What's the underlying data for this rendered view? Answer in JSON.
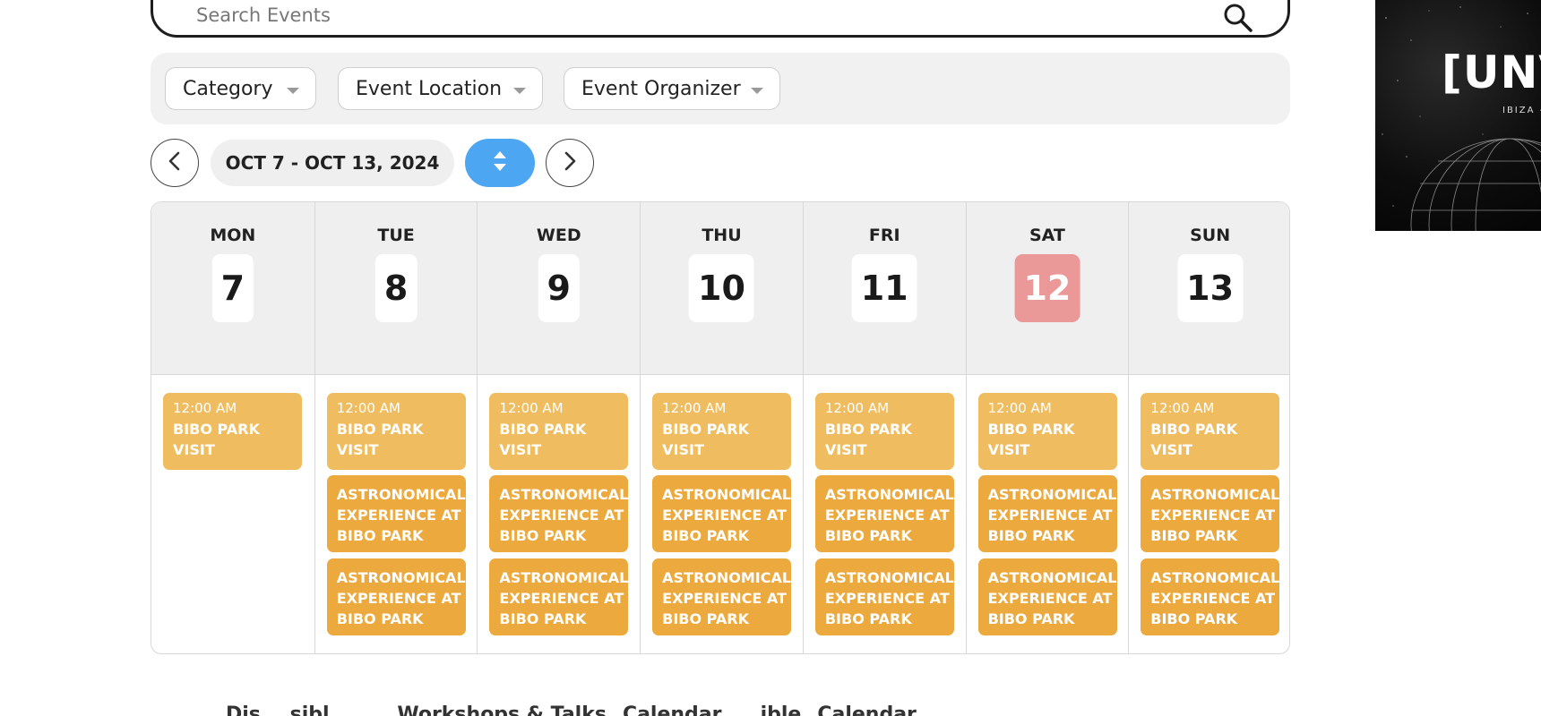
{
  "search": {
    "placeholder": "Search Events"
  },
  "filters": {
    "category": "Category",
    "location": "Event Location",
    "organizer": "Event Organizer"
  },
  "nav": {
    "date_range": "OCT 7 - OCT 13, 2024"
  },
  "colors": {
    "today_highlight": "#ea9898",
    "event_light": "#efbd5f",
    "event_dark": "#eca93d",
    "toggle_button": "#4da6f2"
  },
  "calendar": {
    "days": [
      {
        "name": "MON",
        "number": "7",
        "today": false,
        "events": [
          {
            "time": "12:00 AM",
            "title": "BIBO PARK\nVISIT"
          }
        ]
      },
      {
        "name": "TUE",
        "number": "8",
        "today": false,
        "events": [
          {
            "time": "12:00 AM",
            "title": "BIBO PARK\nVISIT"
          },
          {
            "title": "ASTRONOMICAL\nEXPERIENCE AT\nBIBO PARK"
          },
          {
            "title": "ASTRONOMICAL\nEXPERIENCE AT\nBIBO PARK"
          }
        ]
      },
      {
        "name": "WED",
        "number": "9",
        "today": false,
        "events": [
          {
            "time": "12:00 AM",
            "title": "BIBO PARK\nVISIT"
          },
          {
            "title": "ASTRONOMICAL\nEXPERIENCE AT\nBIBO PARK"
          },
          {
            "title": "ASTRONOMICAL\nEXPERIENCE AT\nBIBO PARK"
          }
        ]
      },
      {
        "name": "THU",
        "number": "10",
        "today": false,
        "events": [
          {
            "time": "12:00 AM",
            "title": "BIBO PARK\nVISIT"
          },
          {
            "title": "ASTRONOMICAL\nEXPERIENCE AT\nBIBO PARK"
          },
          {
            "title": "ASTRONOMICAL\nEXPERIENCE AT\nBIBO PARK"
          }
        ]
      },
      {
        "name": "FRI",
        "number": "11",
        "today": false,
        "events": [
          {
            "time": "12:00 AM",
            "title": "BIBO PARK\nVISIT"
          },
          {
            "title": "ASTRONOMICAL\nEXPERIENCE AT\nBIBO PARK"
          },
          {
            "title": "ASTRONOMICAL\nEXPERIENCE AT\nBIBO PARK"
          }
        ]
      },
      {
        "name": "SAT",
        "number": "12",
        "today": true,
        "events": [
          {
            "time": "12:00 AM",
            "title": "BIBO PARK\nVISIT"
          },
          {
            "title": "ASTRONOMICAL\nEXPERIENCE AT\nBIBO PARK"
          },
          {
            "title": "ASTRONOMICAL\nEXPERIENCE AT\nBIBO PARK"
          }
        ]
      },
      {
        "name": "SUN",
        "number": "13",
        "today": false,
        "events": [
          {
            "time": "12:00 AM",
            "title": "BIBO PARK\nVISIT"
          },
          {
            "title": "ASTRONOMICAL\nEXPERIENCE AT\nBIBO PARK"
          },
          {
            "title": "ASTRONOMICAL\nEXPERIENCE AT\nBIBO PARK"
          }
        ]
      }
    ]
  },
  "promo": {
    "title": "[UNV",
    "subtitle": "IBIZA -"
  },
  "bottom_links": [
    "Dis... sibl... ...",
    "Workshops & Talks",
    "Calendar",
    "...ible",
    "Calendar",
    "..."
  ]
}
